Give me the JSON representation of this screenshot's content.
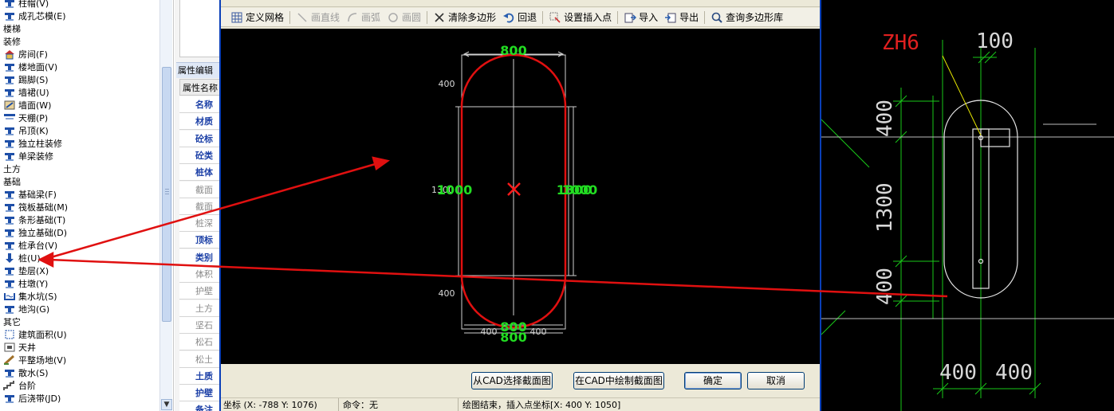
{
  "tree": {
    "rows": [
      {
        "type": "item",
        "icon": "column-cap-icon",
        "label": "柱帽(V)"
      },
      {
        "type": "item",
        "icon": "bored-core-icon",
        "label": "成孔芯模(E)"
      },
      {
        "type": "category",
        "label": "楼梯"
      },
      {
        "type": "category",
        "label": "装修"
      },
      {
        "type": "item",
        "icon": "room-icon",
        "label": "房间(F)"
      },
      {
        "type": "item",
        "icon": "floor-surface-icon",
        "label": "楼地面(V)"
      },
      {
        "type": "item",
        "icon": "skirting-icon",
        "label": "踢脚(S)"
      },
      {
        "type": "item",
        "icon": "wall-skirt-icon",
        "label": "墙裙(U)"
      },
      {
        "type": "item",
        "icon": "wall-surface-icon",
        "label": "墙面(W)"
      },
      {
        "type": "item",
        "icon": "ceiling-icon",
        "label": "天棚(P)"
      },
      {
        "type": "item",
        "icon": "suspended-ceiling-icon",
        "label": "吊顶(K)"
      },
      {
        "type": "item",
        "icon": "column-finish-icon",
        "label": "独立柱装修"
      },
      {
        "type": "item",
        "icon": "beam-finish-icon",
        "label": "单梁装修"
      },
      {
        "type": "category",
        "label": "土方"
      },
      {
        "type": "category",
        "label": "基础"
      },
      {
        "type": "item",
        "icon": "foundation-beam-icon",
        "label": "基础梁(F)"
      },
      {
        "type": "item",
        "icon": "raft-foundation-icon",
        "label": "筏板基础(M)"
      },
      {
        "type": "item",
        "icon": "strip-foundation-icon",
        "label": "条形基础(T)"
      },
      {
        "type": "item",
        "icon": "isolated-foundation-icon",
        "label": "独立基础(D)"
      },
      {
        "type": "item",
        "icon": "pile-cap-icon",
        "label": "桩承台(V)"
      },
      {
        "type": "item",
        "icon": "pile-icon",
        "label": "桩(U)"
      },
      {
        "type": "item",
        "icon": "cushion-icon",
        "label": "垫层(X)"
      },
      {
        "type": "item",
        "icon": "pier-icon",
        "label": "柱墩(Y)"
      },
      {
        "type": "item",
        "icon": "sump-icon",
        "label": "集水坑(S)"
      },
      {
        "type": "item",
        "icon": "trench-icon",
        "label": "地沟(G)"
      },
      {
        "type": "category",
        "label": "其它"
      },
      {
        "type": "item",
        "icon": "building-area-icon",
        "label": "建筑面积(U)"
      },
      {
        "type": "item",
        "icon": "patio-icon",
        "label": "天井"
      },
      {
        "type": "item",
        "icon": "site-leveling-icon",
        "label": "平整场地(V)"
      },
      {
        "type": "item",
        "icon": "apron-icon",
        "label": "散水(S)"
      },
      {
        "type": "item",
        "icon": "steps-icon",
        "label": "台阶"
      },
      {
        "type": "item",
        "icon": "post-pour-strip-icon",
        "label": "后浇带(JD)"
      }
    ]
  },
  "props": {
    "title": "属性编辑",
    "header": "属性名称",
    "rows": [
      {
        "label": "名称",
        "style": "blue"
      },
      {
        "label": "材质",
        "style": "blue"
      },
      {
        "label": "砼标",
        "style": "blue"
      },
      {
        "label": "砼类",
        "style": "blue"
      },
      {
        "label": "桩体",
        "style": "blue"
      },
      {
        "label": "截面",
        "style": "gray"
      },
      {
        "label": "截面",
        "style": "gray"
      },
      {
        "label": "桩深",
        "style": "gray"
      },
      {
        "label": "顶标",
        "style": "blue"
      },
      {
        "label": "类别",
        "style": "blue"
      },
      {
        "label": "体积",
        "style": "gray"
      },
      {
        "label": "护壁",
        "style": "gray"
      },
      {
        "label": "土方",
        "style": "gray"
      },
      {
        "label": "坚石",
        "style": "gray"
      },
      {
        "label": "松石",
        "style": "gray"
      },
      {
        "label": "松土",
        "style": "gray"
      },
      {
        "label": "土质",
        "style": "blue"
      },
      {
        "label": "护壁",
        "style": "blue"
      },
      {
        "label": "备注",
        "style": "blue"
      }
    ]
  },
  "toolbar": {
    "items": [
      {
        "icon": "grid-icon",
        "label": "定义网格",
        "enabled": true
      },
      {
        "icon": "line-icon",
        "label": "画直线",
        "enabled": false
      },
      {
        "icon": "arc-icon",
        "label": "画弧",
        "enabled": false
      },
      {
        "icon": "circle-icon",
        "label": "画圆",
        "enabled": false
      },
      {
        "icon": "clear-icon",
        "label": "清除多边形",
        "enabled": true
      },
      {
        "icon": "undo-icon",
        "label": "回退",
        "enabled": true
      },
      {
        "icon": "insert-point-icon",
        "label": "设置插入点",
        "enabled": true
      },
      {
        "icon": "import-icon",
        "label": "导入",
        "enabled": true
      },
      {
        "icon": "export-icon",
        "label": "导出",
        "enabled": true
      },
      {
        "icon": "search-icon",
        "label": "查询多边形库",
        "enabled": true
      }
    ]
  },
  "drawing": {
    "top_dim": "800",
    "bottom_dim": "800",
    "bottom_dim_left": "400",
    "bottom_dim_right": "400",
    "left_top": "400",
    "left_bottom": "400",
    "left_mid": "1300",
    "left_mid_overlap": "1000",
    "right_mid": "1300",
    "right_mid_overlap": "1000"
  },
  "buttons": {
    "select_from_cad": "从CAD选择截面图",
    "draw_in_cad": "在CAD中绘制截面图",
    "ok": "确定",
    "cancel": "取消"
  },
  "status": {
    "coords": "坐标 (X: -788 Y: 1076)",
    "command": "命令：无",
    "message": "绘图结束，插入点坐标[X: 400 Y: 1050]"
  },
  "cad": {
    "tag": "ZH6",
    "top_dim": "100",
    "left_top": "400",
    "left_mid": "1300",
    "left_bottom": "400",
    "bottom_left": "400",
    "bottom_right": "400"
  },
  "colors": {
    "dialog_frame": "#0a3fb8",
    "canvas_bg": "#000000",
    "shape_stroke": "#e01010",
    "dim_text": "#22dd22",
    "cad_tag": "#e02020",
    "cad_dim": "#19c819",
    "arrow": "#e01010"
  }
}
